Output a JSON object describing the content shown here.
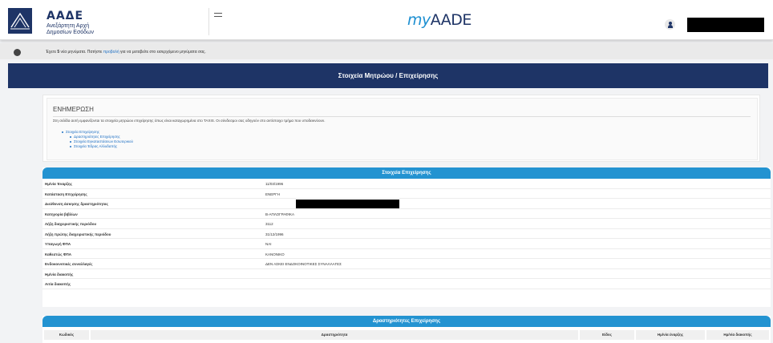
{
  "header": {
    "logo_title": "ΑΑΔΕ",
    "logo_subtitle": "Ανεξάρτητη Αρχή Δημοσίων Εσόδων",
    "brand_prefix": "my",
    "brand_suffix": "AADE"
  },
  "message_bar": {
    "text_before": "Έχετε",
    "count": "5",
    "text_middle": "νέα μηνύματα. Πατήστε",
    "link": "προβολή",
    "text_after": "για να μεταβείτε στο εισερχόμενο μηνύματα σας."
  },
  "page_title": "Στοιχεία Μητρώου / Επιχείρησης",
  "info": {
    "title": "ΕΝΗΜΕΡΩΣΗ",
    "description": "Στη σελίδα αυτή εμφανίζονται τα στοιχεία μητρώου επιχείρησης όπως είναι καταχωρημένα στο TAXIS. Οι σύνδεσμοι σας οδηγούν στο αντίστοιχο τμήμα που υποδεικνύουν.",
    "links": [
      {
        "label": "Στοιχεία Επιχείρησης",
        "level": 1
      },
      {
        "label": "Δραστηριότητες Επιχείρησης",
        "level": 2
      },
      {
        "label": "Στοιχεία Εγκαταστάσεων Εσωτερικού",
        "level": 2
      },
      {
        "label": "Στοιχεία Έδρας Αλλοδαπής",
        "level": 2
      }
    ]
  },
  "company_panel": {
    "title": "Στοιχεία Επιχείρησης",
    "rows": [
      {
        "label": "Ημ/νία Έναρξης",
        "value": "11/03/1996"
      },
      {
        "label": "Κατάσταση Επιχείρησης",
        "value": "ΕΝΕΡΓΗ"
      },
      {
        "label": "Διεύθυνση άσκησης δραστηριότητας",
        "value": ""
      },
      {
        "label": "Κατηγορία βιβλίων",
        "value": "Β-ΑΠΛΟΓΡΑΦΙΚΑ"
      },
      {
        "label": "Λήξη διαχειριστικής περιόδου",
        "value": "3112"
      },
      {
        "label": "Λήξη πρώτης διαχειριστικής περιόδου",
        "value": "31/12/1996"
      },
      {
        "label": "Υπαγωγή ΦΠΑ",
        "value": "ΝΑΙ"
      },
      {
        "label": "Καθεστώς ΦΠΑ",
        "value": "ΚΑΝΟΝΙΚΟ"
      },
      {
        "label": "Ενδοκοινοτικές συναλλαγές",
        "value": "ΔΕΝ ΑΣΚΕΙ ΕΝΔΟΚΟΙΝΟΤΙΚΕΣ ΣΥΝΑΛΛΑΓΕΣ"
      },
      {
        "label": "Ημ/νία διακοπής",
        "value": ""
      },
      {
        "label": "Αιτία διακοπής",
        "value": ""
      }
    ]
  },
  "activities_panel": {
    "title": "Δραστηριότητες Επιχείρησης",
    "columns": [
      "Κωδικός",
      "Δραστηριότητα",
      "Είδος",
      "Ημ/νία έναρξης",
      "Ημ/νία διακοπής"
    ]
  },
  "colors": {
    "navy": "#1e3466",
    "blue": "#2393d1",
    "link": "#1d6fc3"
  }
}
